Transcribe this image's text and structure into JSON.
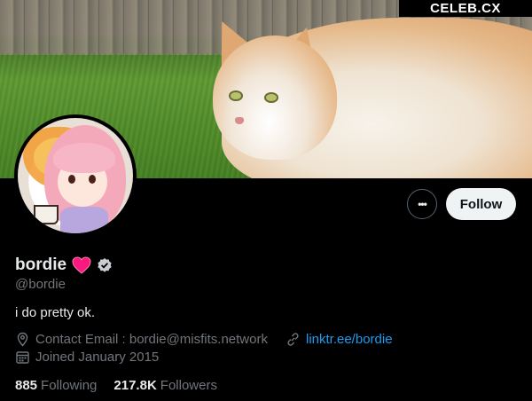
{
  "watermark": "CELEB.CX",
  "profile": {
    "name": "bordie",
    "handle": "@bordie",
    "bio": "i do pretty ok.",
    "contact": "Contact Email : bordie@misfits.network",
    "link": "linktr.ee/bordie",
    "joined": "Joined January 2015",
    "following_count": "885",
    "following_label": "Following",
    "followers_count": "217.8K",
    "followers_label": "Followers"
  },
  "actions": {
    "more_label": "•••",
    "follow_label": "Follow"
  },
  "icons": {
    "heart": "heart-icon",
    "verified": "verified-badge-icon",
    "location": "location-pin-icon",
    "link": "link-icon",
    "calendar": "calendar-icon"
  },
  "colors": {
    "background": "#000000",
    "text_primary": "#e7e9ea",
    "text_secondary": "#71767b",
    "link": "#1d9bf0",
    "follow_button_bg": "#eff3f4",
    "heart": "#f91880"
  }
}
